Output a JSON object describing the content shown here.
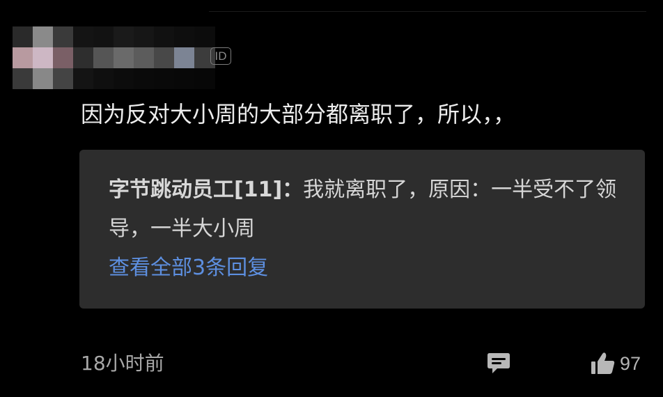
{
  "comment": {
    "id_badge": "ID",
    "text": "因为反对大小周的大部分都离职了，所以，，",
    "timestamp": "18小时前",
    "like_count": "97"
  },
  "reply": {
    "author": "字节跳动员工[11]：",
    "text": "我就离职了，原因：一半受不了领导，一半大小周",
    "view_all": "查看全部3条回复"
  },
  "icons": {
    "reply": "comment-bubble-icon",
    "like": "thumbs-up-icon"
  },
  "colors": {
    "background": "#000000",
    "reply_box": "#2d2d2d",
    "link": "#5d8fe0",
    "text": "#ededed",
    "muted": "#a8a8a8"
  }
}
